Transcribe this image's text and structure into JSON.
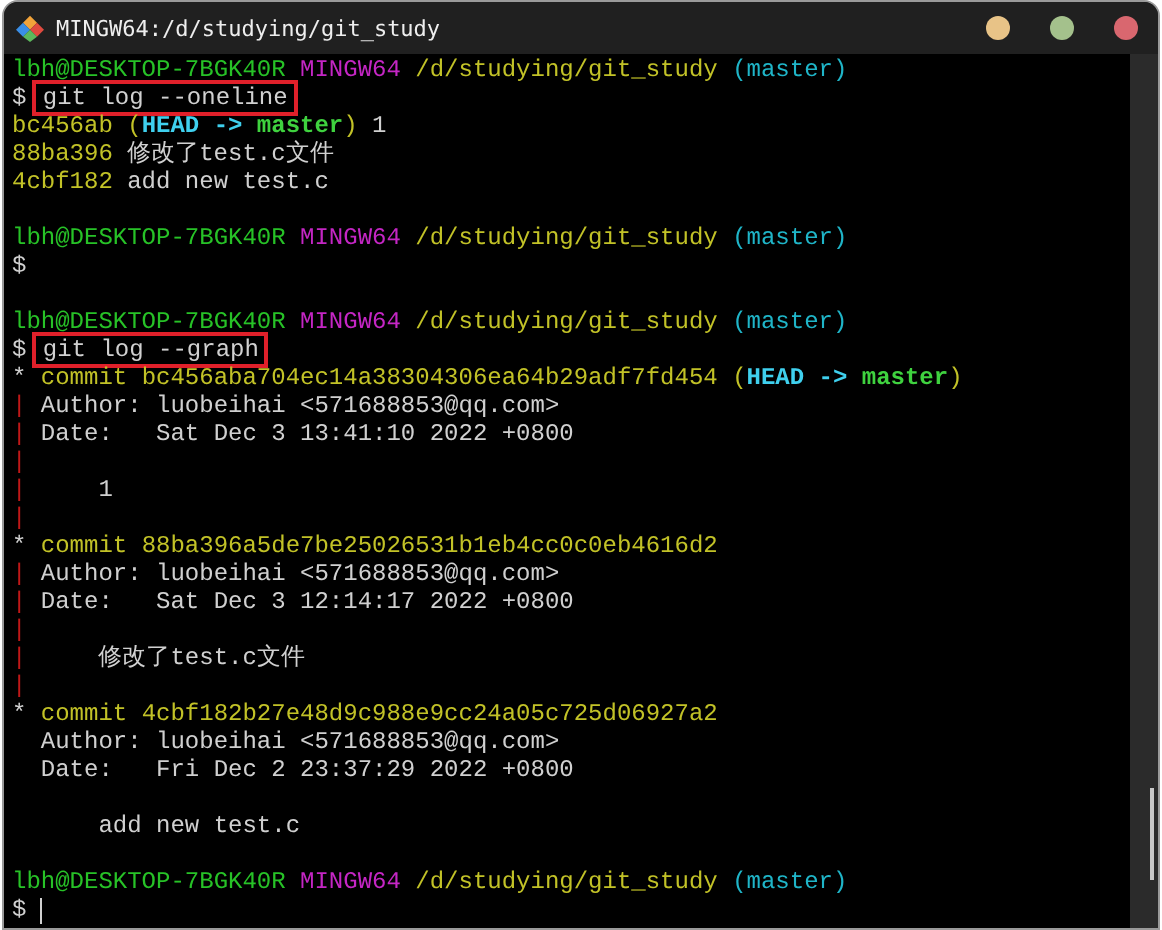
{
  "window": {
    "title": "MINGW64:/d/studying/git_study"
  },
  "terminal": {
    "lines": [
      {
        "kind": "text",
        "segments": [
          {
            "text": "lbh@DESKTOP-7BGK40R ",
            "kind": "user"
          },
          {
            "text": "MINGW64 ",
            "kind": "host"
          },
          {
            "text": "/d/studying/git_study ",
            "kind": "path"
          },
          {
            "text": "(master)",
            "kind": "branch"
          }
        ]
      },
      {
        "kind": "text",
        "segments": [
          {
            "text": "$ ",
            "kind": "dollar"
          },
          {
            "text": "git log --oneline",
            "kind": "command",
            "boxed": true
          }
        ]
      },
      {
        "kind": "text",
        "segments": [
          {
            "text": "bc456ab ",
            "kind": "hash"
          },
          {
            "text": "(",
            "kind": "hash"
          },
          {
            "text": "HEAD -> ",
            "kind": "head"
          },
          {
            "text": "master",
            "kind": "ref"
          },
          {
            "text": ")",
            "kind": "hash"
          },
          {
            "text": " 1",
            "kind": "plain"
          }
        ]
      },
      {
        "kind": "text",
        "segments": [
          {
            "text": "88ba396 ",
            "kind": "hash"
          },
          {
            "text": "修改了test.c文件",
            "kind": "plain"
          }
        ]
      },
      {
        "kind": "text",
        "segments": [
          {
            "text": "4cbf182 ",
            "kind": "hash"
          },
          {
            "text": "add new test.c",
            "kind": "plain"
          }
        ]
      },
      {
        "kind": "blank"
      },
      {
        "kind": "text",
        "segments": [
          {
            "text": "lbh@DESKTOP-7BGK40R ",
            "kind": "user"
          },
          {
            "text": "MINGW64 ",
            "kind": "host"
          },
          {
            "text": "/d/studying/git_study ",
            "kind": "path"
          },
          {
            "text": "(master)",
            "kind": "branch"
          }
        ]
      },
      {
        "kind": "text",
        "segments": [
          {
            "text": "$",
            "kind": "dollar"
          }
        ]
      },
      {
        "kind": "blank"
      },
      {
        "kind": "text",
        "segments": [
          {
            "text": "lbh@DESKTOP-7BGK40R ",
            "kind": "user"
          },
          {
            "text": "MINGW64 ",
            "kind": "host"
          },
          {
            "text": "/d/studying/git_study ",
            "kind": "path"
          },
          {
            "text": "(master)",
            "kind": "branch"
          }
        ]
      },
      {
        "kind": "text",
        "segments": [
          {
            "text": "$ ",
            "kind": "dollar"
          },
          {
            "text": "git log --graph",
            "kind": "command",
            "boxed": true
          }
        ]
      },
      {
        "kind": "text",
        "segments": [
          {
            "text": "* ",
            "kind": "node"
          },
          {
            "text": "commit bc456aba704ec14a38304306ea64b29adf7fd454 (",
            "kind": "hash"
          },
          {
            "text": "HEAD -> ",
            "kind": "head"
          },
          {
            "text": "master",
            "kind": "ref"
          },
          {
            "text": ")",
            "kind": "hash"
          }
        ]
      },
      {
        "kind": "text",
        "segments": [
          {
            "text": "|",
            "kind": "graph"
          },
          {
            "text": " Author: luobeihai <571688853@qq.com>",
            "kind": "plain"
          }
        ]
      },
      {
        "kind": "text",
        "segments": [
          {
            "text": "|",
            "kind": "graph"
          },
          {
            "text": " Date:   Sat Dec 3 13:41:10 2022 +0800",
            "kind": "plain"
          }
        ]
      },
      {
        "kind": "text",
        "segments": [
          {
            "text": "|",
            "kind": "graph"
          }
        ]
      },
      {
        "kind": "text",
        "segments": [
          {
            "text": "|",
            "kind": "graph"
          },
          {
            "text": "     1",
            "kind": "plain"
          }
        ]
      },
      {
        "kind": "text",
        "segments": [
          {
            "text": "|",
            "kind": "graph"
          }
        ]
      },
      {
        "kind": "text",
        "segments": [
          {
            "text": "* ",
            "kind": "node"
          },
          {
            "text": "commit 88ba396a5de7be25026531b1eb4cc0c0eb4616d2",
            "kind": "hash"
          }
        ]
      },
      {
        "kind": "text",
        "segments": [
          {
            "text": "|",
            "kind": "graph"
          },
          {
            "text": " Author: luobeihai <571688853@qq.com>",
            "kind": "plain"
          }
        ]
      },
      {
        "kind": "text",
        "segments": [
          {
            "text": "|",
            "kind": "graph"
          },
          {
            "text": " Date:   Sat Dec 3 12:14:17 2022 +0800",
            "kind": "plain"
          }
        ]
      },
      {
        "kind": "text",
        "segments": [
          {
            "text": "|",
            "kind": "graph"
          }
        ]
      },
      {
        "kind": "text",
        "segments": [
          {
            "text": "|",
            "kind": "graph"
          },
          {
            "text": "     修改了test.c文件",
            "kind": "plain"
          }
        ]
      },
      {
        "kind": "text",
        "segments": [
          {
            "text": "|",
            "kind": "graph"
          }
        ]
      },
      {
        "kind": "text",
        "segments": [
          {
            "text": "* ",
            "kind": "node"
          },
          {
            "text": "commit 4cbf182b27e48d9c988e9cc24a05c725d06927a2",
            "kind": "hash"
          }
        ]
      },
      {
        "kind": "text",
        "segments": [
          {
            "text": "  Author: luobeihai <571688853@qq.com>",
            "kind": "plain"
          }
        ]
      },
      {
        "kind": "text",
        "segments": [
          {
            "text": "  Date:   Fri Dec 2 23:37:29 2022 +0800",
            "kind": "plain"
          }
        ]
      },
      {
        "kind": "blank"
      },
      {
        "kind": "text",
        "segments": [
          {
            "text": "      add new test.c",
            "kind": "plain"
          }
        ]
      },
      {
        "kind": "blank"
      },
      {
        "kind": "text",
        "segments": [
          {
            "text": "lbh@DESKTOP-7BGK40R ",
            "kind": "user"
          },
          {
            "text": "MINGW64 ",
            "kind": "host"
          },
          {
            "text": "/d/studying/git_study ",
            "kind": "path"
          },
          {
            "text": "(master)",
            "kind": "branch"
          }
        ]
      },
      {
        "kind": "text",
        "cursor": true,
        "segments": [
          {
            "text": "$ ",
            "kind": "dollar"
          }
        ]
      }
    ]
  }
}
